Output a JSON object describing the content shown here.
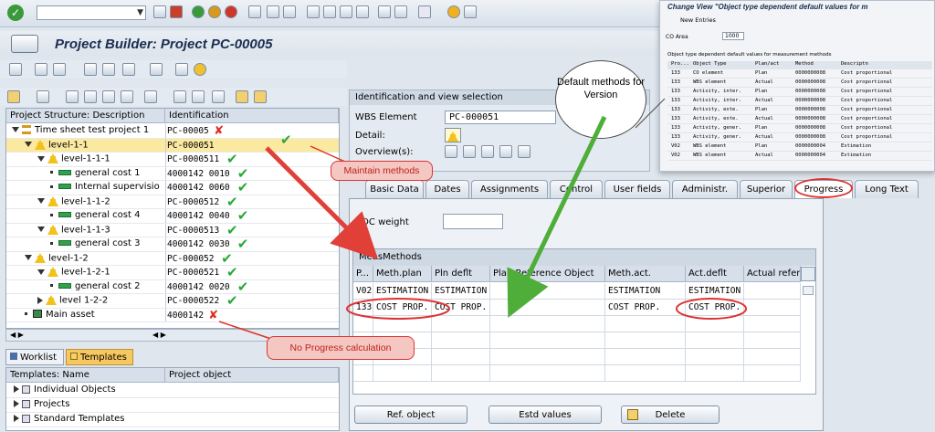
{
  "app_title": "Project Builder: Project PC-00005",
  "tree": {
    "headers": [
      "Project Structure: Description",
      "Identification"
    ],
    "rows": [
      {
        "label": "Time sheet test project 1",
        "id": "PC-00005",
        "level": 0,
        "kind": "project",
        "mark": "cross"
      },
      {
        "label": "level-1-1",
        "id": "PC-000051",
        "level": 1,
        "kind": "wbs",
        "mark": "check",
        "selected": true
      },
      {
        "label": "level-1-1-1",
        "id": "PC-0000511",
        "level": 2,
        "kind": "wbs",
        "mark": "check"
      },
      {
        "label": "general cost 1",
        "id": "4000142 0010",
        "level": 3,
        "kind": "activity",
        "mark": "check"
      },
      {
        "label": "Internal supervisio",
        "id": "4000142 0060",
        "level": 3,
        "kind": "activity",
        "mark": "check"
      },
      {
        "label": "level-1-1-2",
        "id": "PC-0000512",
        "level": 2,
        "kind": "wbs",
        "mark": "check"
      },
      {
        "label": "general cost 4",
        "id": "4000142 0040",
        "level": 3,
        "kind": "activity",
        "mark": "check"
      },
      {
        "label": "level-1-1-3",
        "id": "PC-0000513",
        "level": 2,
        "kind": "wbs",
        "mark": "check"
      },
      {
        "label": "general cost 3",
        "id": "4000142 0030",
        "level": 3,
        "kind": "activity",
        "mark": "check"
      },
      {
        "label": "level-1-2",
        "id": "PC-000052",
        "level": 1,
        "kind": "wbs",
        "mark": "check"
      },
      {
        "label": "level-1-2-1",
        "id": "PC-0000521",
        "level": 2,
        "kind": "wbs",
        "mark": "check"
      },
      {
        "label": "general cost 2",
        "id": "4000142 0020",
        "level": 3,
        "kind": "activity",
        "mark": "check"
      },
      {
        "label": "level 1-2-2",
        "id": "PC-0000522",
        "level": 2,
        "kind": "wbs",
        "mark": "check"
      },
      {
        "label": "Main asset",
        "id": "4000142",
        "level": 1,
        "kind": "asset",
        "mark": "cross"
      }
    ]
  },
  "worklist_tab": "Worklist",
  "templates_tab": "Templates",
  "templates": {
    "headers": [
      "Templates: Name",
      "Project object"
    ],
    "items": [
      "Individual Objects",
      "Projects",
      "Standard Templates"
    ]
  },
  "identification": {
    "title": "Identification and view selection",
    "wbs_label": "WBS Element",
    "wbs_value": "PC-000051",
    "detail_label": "Detail:",
    "overview_label": "Overview(s):"
  },
  "tabs": [
    "Basic Data",
    "Dates",
    "Assignments",
    "Control",
    "User fields",
    "Administr.",
    "Superior",
    "Progress",
    "Long Text"
  ],
  "active_tab": "Progress",
  "poc_label": "POC weight",
  "meas": {
    "title": "MeasMethods",
    "headers": [
      "P...",
      "Meth.plan",
      "Pln deflt",
      "Plan Reference Object",
      "Meth.act.",
      "Act.deflt",
      "Actual refere"
    ],
    "rows": [
      [
        "V02",
        "ESTIMATION",
        "ESTIMATION",
        "",
        "ESTIMATION",
        "ESTIMATION",
        ""
      ],
      [
        "133",
        "COST PROP.",
        "COST PROP.",
        "",
        "COST PROP.",
        "COST PROP.",
        ""
      ]
    ]
  },
  "buttons": {
    "ref": "Ref. object",
    "estd": "Estd values",
    "delete": "Delete"
  },
  "callouts": {
    "maintain": "Maintain methods",
    "no_progress": "No Progress calculation",
    "default_methods": "Default methods for Version"
  },
  "change_view": {
    "title": "Change View \"Object type dependent default values for m",
    "new_entries": "New Entries",
    "co_area_label": "CO Area",
    "co_area_value": "1000",
    "table_title": "Object type dependent default values for measurement methods",
    "headers": [
      "Pro...",
      "Object Type",
      "Plan/act",
      "Method",
      "Descriptn"
    ],
    "rows": [
      [
        "133",
        "CO element",
        "Plan",
        "0000000008",
        "Cost proportional"
      ],
      [
        "133",
        "WBS element",
        "Actual",
        "0000000008",
        "Cost proportional"
      ],
      [
        "133",
        "Activity, inter.",
        "Plan",
        "0000000008",
        "Cost proportional"
      ],
      [
        "133",
        "Activity, inter.",
        "Actual",
        "0000000008",
        "Cost proportional"
      ],
      [
        "133",
        "Activity, exte.",
        "Plan",
        "0000000008",
        "Cost proportional"
      ],
      [
        "133",
        "Activity, exte.",
        "Actual",
        "0000000008",
        "Cost proportional"
      ],
      [
        "133",
        "Activity, gener.",
        "Plan",
        "0000000008",
        "Cost proportional"
      ],
      [
        "133",
        "Activity, gener.",
        "Actual",
        "0000000008",
        "Cost proportional"
      ],
      [
        "V02",
        "WBS element",
        "Plan",
        "0000000004",
        "Estimation"
      ],
      [
        "V02",
        "WBS element",
        "Actual",
        "0000000004",
        "Estimation"
      ]
    ]
  },
  "colors": {
    "highlight": "#fbe9a0",
    "check": "#29a838",
    "cross": "#e32b24",
    "callout_border": "#dd3322"
  }
}
